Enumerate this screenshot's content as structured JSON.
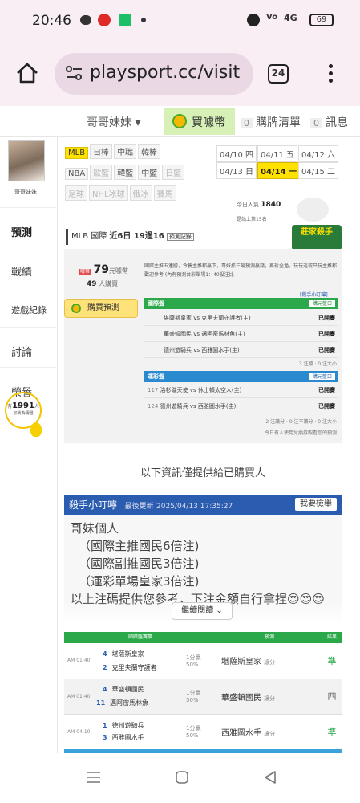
{
  "status_bar": {
    "time": "20:46",
    "battery": "69",
    "network": "4G"
  },
  "browser": {
    "url": "playsport.cc/visit",
    "tab_count": "24"
  },
  "top_nav": {
    "user": "哥哥妹妹",
    "buy": "買噱幣",
    "list_count": "0",
    "list_label": "購牌清單",
    "msg_count": "0",
    "msg_label": "訊息"
  },
  "sidebar": {
    "user_name": "哥哥妹妹",
    "items": [
      "預測",
      "戰績",
      "遊戲紀錄",
      "討論",
      "榮譽"
    ],
    "fans_prefix": "有",
    "fans": "1991",
    "fans_suffix": "人",
    "fans_sub": "加我為明燈"
  },
  "leagues": {
    "row1": [
      "MLB",
      "日棒",
      "中職",
      "韓棒"
    ],
    "row2": [
      "NBA",
      "歐籃",
      "韓籃",
      "中籃",
      "日籃"
    ],
    "row3": [
      "足球",
      "NHL冰球",
      "俄冰",
      "賽馬"
    ]
  },
  "dates": [
    "04/10 四",
    "04/11 五",
    "04/12 六",
    "04/13 日",
    "04/14 一",
    "04/15 二"
  ],
  "views": {
    "label": "今日人氣",
    "value": "1840",
    "rank": "是站上第15名"
  },
  "record": {
    "league": "MLB 國際",
    "title": "近6日 19過16",
    "link": "預測記錄",
    "badge": "莊家殺手"
  },
  "price": {
    "value": "79",
    "unit": "元噱幣",
    "buyers": "49",
    "buyers_unit": "人購買",
    "buy_button": "購買預測",
    "note": "國際主推五連勝，今隻主推都贏下，哥妹抓三場預測贏錢，再祈全過，玩玩這或只玩主推都歡迎參考 (內有預測台彩單場1：40投注比"
  },
  "intl": {
    "head": "國際盤",
    "btn": "購元盤口",
    "link": "[殺手小叮嚀]",
    "rows": [
      {
        "teams": "堪薩斯皇家 vs 克里夫蘭守護者(主)",
        "status": "已開賽"
      },
      {
        "teams": "華盛頓國民 vs 邁阿密馬林魚(主)",
        "status": "已開賽"
      },
      {
        "teams": "德州遊騎兵 vs 西雅圖水手(主)",
        "status": "已開賽"
      }
    ],
    "summary": "3 注勝 · 0 注大小"
  },
  "lottery": {
    "head": "運彩盤",
    "btn": "購元盤口",
    "rows": [
      {
        "no": "117",
        "teams": "洛杉磯天使 vs 休士頓太空人(主)",
        "status": "已開賽"
      },
      {
        "no": "124",
        "teams": "德州遊騎兵 vs 西雅圖水手(主)",
        "status": "已開賽"
      }
    ],
    "summary": "2 注讓分 · 0 注不讓分 · 0 注大小",
    "footer": "今日有人使用兌換券觀看您的預測"
  },
  "info_text": "以下資訊僅提供給已購買人",
  "killer": {
    "title": "殺手小叮嚀",
    "updated_label": "最後更新",
    "updated": "2025/04/13 17:35:27",
    "check_btn": "我要檢舉",
    "lines": [
      "哥妹個人",
      "（國際主推國民6倍注)",
      "（國際副推國民3倍注)",
      "（運彩單場皇家3倍注)",
      "以上注碼提供您參考，下注金額自行拿捏😍😍😍"
    ],
    "more": "繼續閱讀"
  },
  "picks": {
    "headers": [
      "國際盤賽事",
      "預測",
      "結果"
    ],
    "rows": [
      {
        "time": "AM 01:40",
        "a_no": "4",
        "a": "堪薩斯皇家",
        "b_no": "2",
        "b": "克里夫蘭守護者",
        "line": "1分贏",
        "pct": "50%",
        "pick": "堪薩斯皇家",
        "pick_type": "讓分",
        "result": "準"
      },
      {
        "time": "AM 01:40",
        "a_no": "4",
        "a": "華盛頓國民",
        "b_no": "11",
        "b": "邁阿密馬林魚",
        "line": "1分贏",
        "pct": "50%",
        "pick": "華盛頓國民",
        "pick_type": "讓分",
        "result": "四"
      },
      {
        "time": "AM 04:10",
        "a_no": "1",
        "a": "德州遊騎兵",
        "b_no": "3",
        "b": "西雅圖水手",
        "line": "1分贏",
        "pct": "50%",
        "pick": "西雅圖水手",
        "pick_type": "讓分",
        "result": "準"
      }
    ]
  }
}
